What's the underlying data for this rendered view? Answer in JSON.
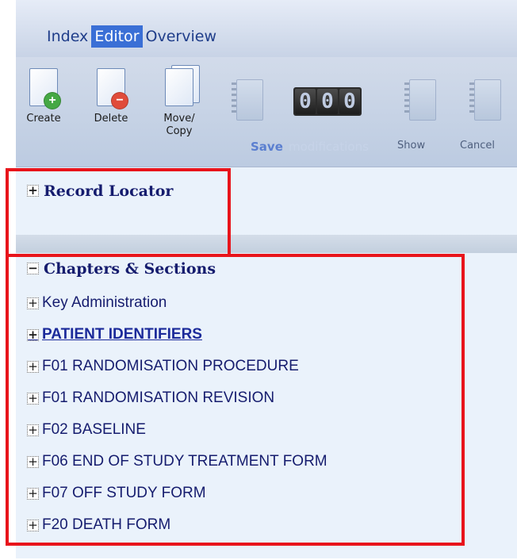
{
  "tabs": [
    {
      "label": "Index",
      "active": false
    },
    {
      "label": "Editor",
      "active": true
    },
    {
      "label": "Overview",
      "active": false
    }
  ],
  "toolbar": {
    "create_label": "Create",
    "delete_label": "Delete",
    "move_copy_label_line1": "Move/",
    "move_copy_label_line2": "Copy",
    "modification_count": [
      "0",
      "0",
      "0"
    ],
    "save_label": "Save",
    "modifications_label": "modifications",
    "show_label": "Show",
    "cancel_label": "Cancel"
  },
  "record_locator": {
    "title": "Record Locator",
    "expander": "+"
  },
  "chapters": {
    "title": "Chapters & Sections",
    "expander": "−",
    "items": [
      {
        "label": "Key Administration",
        "expander": "+"
      },
      {
        "label": "PATIENT IDENTIFIERS",
        "expander": "+",
        "linked": true
      },
      {
        "label": "F01 RANDOMISATION PROCEDURE",
        "expander": "+"
      },
      {
        "label": "F01 RANDOMISATION REVISION",
        "expander": "+"
      },
      {
        "label": "F02 BASELINE",
        "expander": "+"
      },
      {
        "label": "F06 END OF STUDY TREATMENT FORM",
        "expander": "+"
      },
      {
        "label": "F07 OFF STUDY FORM",
        "expander": "+"
      },
      {
        "label": "F20 DEATH FORM",
        "expander": "+"
      }
    ]
  },
  "colors": {
    "accent": "#3a6fd6",
    "highlight": "#e8141b",
    "tree_text": "#151c6e",
    "save": "#5b7fd0"
  },
  "icons": {
    "create": "document-plus-icon",
    "delete": "document-minus-icon",
    "move_copy": "documents-copy-icon",
    "save": "notebook-arrow-icon",
    "show": "notebook-pencil-icon",
    "cancel": "notebook-minus-icon"
  }
}
